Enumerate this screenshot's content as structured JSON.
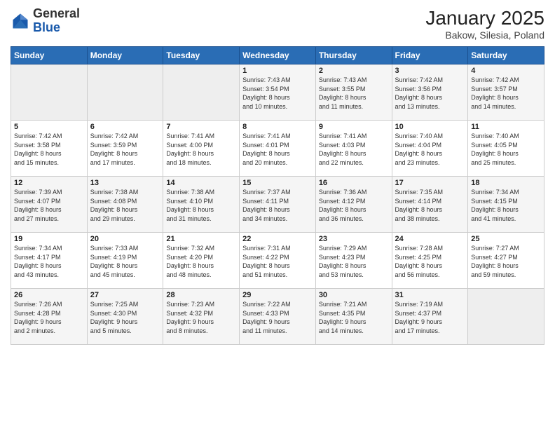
{
  "logo": {
    "general": "General",
    "blue": "Blue"
  },
  "title": "January 2025",
  "location": "Bakow, Silesia, Poland",
  "days_of_week": [
    "Sunday",
    "Monday",
    "Tuesday",
    "Wednesday",
    "Thursday",
    "Friday",
    "Saturday"
  ],
  "weeks": [
    [
      {
        "day": "",
        "info": ""
      },
      {
        "day": "",
        "info": ""
      },
      {
        "day": "",
        "info": ""
      },
      {
        "day": "1",
        "info": "Sunrise: 7:43 AM\nSunset: 3:54 PM\nDaylight: 8 hours\nand 10 minutes."
      },
      {
        "day": "2",
        "info": "Sunrise: 7:43 AM\nSunset: 3:55 PM\nDaylight: 8 hours\nand 11 minutes."
      },
      {
        "day": "3",
        "info": "Sunrise: 7:42 AM\nSunset: 3:56 PM\nDaylight: 8 hours\nand 13 minutes."
      },
      {
        "day": "4",
        "info": "Sunrise: 7:42 AM\nSunset: 3:57 PM\nDaylight: 8 hours\nand 14 minutes."
      }
    ],
    [
      {
        "day": "5",
        "info": "Sunrise: 7:42 AM\nSunset: 3:58 PM\nDaylight: 8 hours\nand 15 minutes."
      },
      {
        "day": "6",
        "info": "Sunrise: 7:42 AM\nSunset: 3:59 PM\nDaylight: 8 hours\nand 17 minutes."
      },
      {
        "day": "7",
        "info": "Sunrise: 7:41 AM\nSunset: 4:00 PM\nDaylight: 8 hours\nand 18 minutes."
      },
      {
        "day": "8",
        "info": "Sunrise: 7:41 AM\nSunset: 4:01 PM\nDaylight: 8 hours\nand 20 minutes."
      },
      {
        "day": "9",
        "info": "Sunrise: 7:41 AM\nSunset: 4:03 PM\nDaylight: 8 hours\nand 22 minutes."
      },
      {
        "day": "10",
        "info": "Sunrise: 7:40 AM\nSunset: 4:04 PM\nDaylight: 8 hours\nand 23 minutes."
      },
      {
        "day": "11",
        "info": "Sunrise: 7:40 AM\nSunset: 4:05 PM\nDaylight: 8 hours\nand 25 minutes."
      }
    ],
    [
      {
        "day": "12",
        "info": "Sunrise: 7:39 AM\nSunset: 4:07 PM\nDaylight: 8 hours\nand 27 minutes."
      },
      {
        "day": "13",
        "info": "Sunrise: 7:38 AM\nSunset: 4:08 PM\nDaylight: 8 hours\nand 29 minutes."
      },
      {
        "day": "14",
        "info": "Sunrise: 7:38 AM\nSunset: 4:10 PM\nDaylight: 8 hours\nand 31 minutes."
      },
      {
        "day": "15",
        "info": "Sunrise: 7:37 AM\nSunset: 4:11 PM\nDaylight: 8 hours\nand 34 minutes."
      },
      {
        "day": "16",
        "info": "Sunrise: 7:36 AM\nSunset: 4:12 PM\nDaylight: 8 hours\nand 36 minutes."
      },
      {
        "day": "17",
        "info": "Sunrise: 7:35 AM\nSunset: 4:14 PM\nDaylight: 8 hours\nand 38 minutes."
      },
      {
        "day": "18",
        "info": "Sunrise: 7:34 AM\nSunset: 4:15 PM\nDaylight: 8 hours\nand 41 minutes."
      }
    ],
    [
      {
        "day": "19",
        "info": "Sunrise: 7:34 AM\nSunset: 4:17 PM\nDaylight: 8 hours\nand 43 minutes."
      },
      {
        "day": "20",
        "info": "Sunrise: 7:33 AM\nSunset: 4:19 PM\nDaylight: 8 hours\nand 45 minutes."
      },
      {
        "day": "21",
        "info": "Sunrise: 7:32 AM\nSunset: 4:20 PM\nDaylight: 8 hours\nand 48 minutes."
      },
      {
        "day": "22",
        "info": "Sunrise: 7:31 AM\nSunset: 4:22 PM\nDaylight: 8 hours\nand 51 minutes."
      },
      {
        "day": "23",
        "info": "Sunrise: 7:29 AM\nSunset: 4:23 PM\nDaylight: 8 hours\nand 53 minutes."
      },
      {
        "day": "24",
        "info": "Sunrise: 7:28 AM\nSunset: 4:25 PM\nDaylight: 8 hours\nand 56 minutes."
      },
      {
        "day": "25",
        "info": "Sunrise: 7:27 AM\nSunset: 4:27 PM\nDaylight: 8 hours\nand 59 minutes."
      }
    ],
    [
      {
        "day": "26",
        "info": "Sunrise: 7:26 AM\nSunset: 4:28 PM\nDaylight: 9 hours\nand 2 minutes."
      },
      {
        "day": "27",
        "info": "Sunrise: 7:25 AM\nSunset: 4:30 PM\nDaylight: 9 hours\nand 5 minutes."
      },
      {
        "day": "28",
        "info": "Sunrise: 7:23 AM\nSunset: 4:32 PM\nDaylight: 9 hours\nand 8 minutes."
      },
      {
        "day": "29",
        "info": "Sunrise: 7:22 AM\nSunset: 4:33 PM\nDaylight: 9 hours\nand 11 minutes."
      },
      {
        "day": "30",
        "info": "Sunrise: 7:21 AM\nSunset: 4:35 PM\nDaylight: 9 hours\nand 14 minutes."
      },
      {
        "day": "31",
        "info": "Sunrise: 7:19 AM\nSunset: 4:37 PM\nDaylight: 9 hours\nand 17 minutes."
      },
      {
        "day": "",
        "info": ""
      }
    ]
  ]
}
